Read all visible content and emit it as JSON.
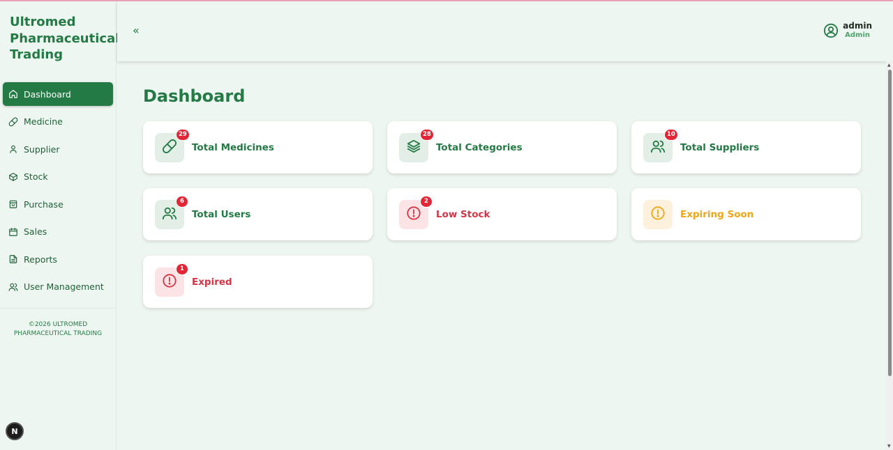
{
  "brand": {
    "name": "Ultromed Pharmaceutical Trading"
  },
  "sidebar": {
    "items": [
      {
        "label": "Dashboard",
        "icon": "home-icon",
        "active": true
      },
      {
        "label": "Medicine",
        "icon": "pill-icon"
      },
      {
        "label": "Supplier",
        "icon": "person-icon"
      },
      {
        "label": "Stock",
        "icon": "box-icon"
      },
      {
        "label": "Purchase",
        "icon": "bag-icon"
      },
      {
        "label": "Sales",
        "icon": "calendar-icon"
      },
      {
        "label": "Reports",
        "icon": "document-icon"
      },
      {
        "label": "User Management",
        "icon": "users-icon"
      }
    ],
    "copyright": "©2026 ULTROMED PHARMACEUTICAL TRADING"
  },
  "header": {
    "collapse_label": "«",
    "user": {
      "name": "admin",
      "role": "Admin"
    }
  },
  "page": {
    "title": "Dashboard"
  },
  "cards": [
    {
      "label": "Total Medicines",
      "count": "29",
      "tone": "green",
      "icon": "pill-icon"
    },
    {
      "label": "Total Categories",
      "count": "28",
      "tone": "green",
      "icon": "layers-icon"
    },
    {
      "label": "Total Suppliers",
      "count": "10",
      "tone": "green",
      "icon": "users-icon"
    },
    {
      "label": "Total Users",
      "count": "6",
      "tone": "green",
      "icon": "users-icon"
    },
    {
      "label": "Low Stock",
      "count": "2",
      "tone": "red",
      "icon": "alert-circle-icon"
    },
    {
      "label": "Expiring Soon",
      "count": null,
      "tone": "amber",
      "icon": "alert-circle-icon"
    },
    {
      "label": "Expired",
      "count": "1",
      "tone": "red",
      "icon": "alert-circle-icon"
    }
  ],
  "devtools": {
    "label": "N"
  },
  "colors": {
    "accent": "#237a44",
    "danger": "#d63445",
    "warning": "#f0a616",
    "badge": "#e32636"
  }
}
